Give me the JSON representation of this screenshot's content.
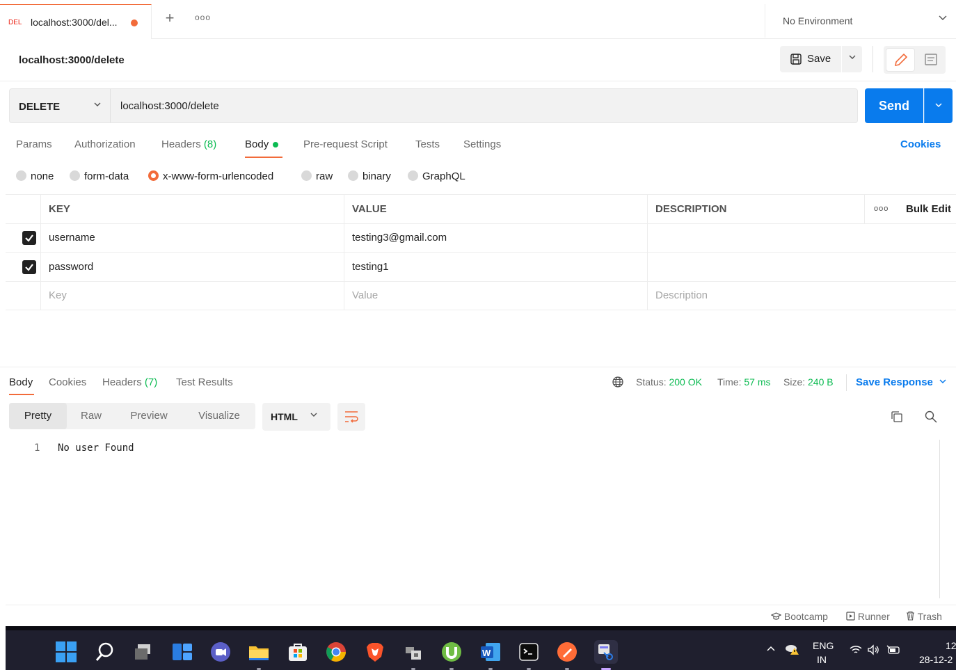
{
  "tabs": {
    "active": {
      "method": "DEL",
      "title": "localhost:3000/del...",
      "unsaved_color": "#f26b3a"
    },
    "add_icon": "plus-icon",
    "more_icon": "more-horizontal-icon"
  },
  "environment": {
    "label": "No Environment"
  },
  "request": {
    "title": "localhost:3000/delete",
    "save_label": "Save",
    "method": "DELETE",
    "url": "localhost:3000/delete",
    "send_label": "Send"
  },
  "request_tabs": [
    {
      "label": "Params"
    },
    {
      "label": "Authorization"
    },
    {
      "label": "Headers",
      "count": "(8)"
    },
    {
      "label": "Body"
    },
    {
      "label": "Pre-request Script"
    },
    {
      "label": "Tests"
    },
    {
      "label": "Settings"
    }
  ],
  "cookies_label": "Cookies",
  "body_types": [
    {
      "label": "none",
      "selected": false
    },
    {
      "label": "form-data",
      "selected": false
    },
    {
      "label": "x-www-form-urlencoded",
      "selected": true
    },
    {
      "label": "raw",
      "selected": false
    },
    {
      "label": "binary",
      "selected": false
    },
    {
      "label": "GraphQL",
      "selected": false
    }
  ],
  "params_table": {
    "headers": {
      "key": "KEY",
      "value": "VALUE",
      "description": "DESCRIPTION",
      "bulk_edit": "Bulk Edit"
    },
    "rows": [
      {
        "key": "username",
        "value": "testing3@gmail.com",
        "description": "",
        "checked": true
      },
      {
        "key": "password",
        "value": "testing1",
        "description": "",
        "checked": true
      }
    ],
    "placeholders": {
      "key": "Key",
      "value": "Value",
      "description": "Description"
    }
  },
  "response": {
    "tabs": [
      {
        "label": "Body"
      },
      {
        "label": "Cookies"
      },
      {
        "label": "Headers",
        "count": "(7)"
      },
      {
        "label": "Test Results"
      }
    ],
    "status_label": "Status:",
    "status_value": "200 OK",
    "time_label": "Time:",
    "time_value": "57 ms",
    "size_label": "Size:",
    "size_value": "240 B",
    "save_response": "Save Response",
    "view_modes": [
      "Pretty",
      "Raw",
      "Preview",
      "Visualize"
    ],
    "format": "HTML",
    "lines": [
      {
        "no": "1",
        "text": "No user Found"
      }
    ]
  },
  "statusbar": {
    "bootcamp": "Bootcamp",
    "runner": "Runner",
    "trash": "Trash"
  },
  "taskbar": {
    "lang_top": "ENG",
    "lang_bottom": "IN",
    "time": "12",
    "date": "28-12-2"
  },
  "colors": {
    "accent": "#f26b3a",
    "primary": "#097bed",
    "success": "#0cbb52",
    "delete_method": "#eb2013"
  }
}
